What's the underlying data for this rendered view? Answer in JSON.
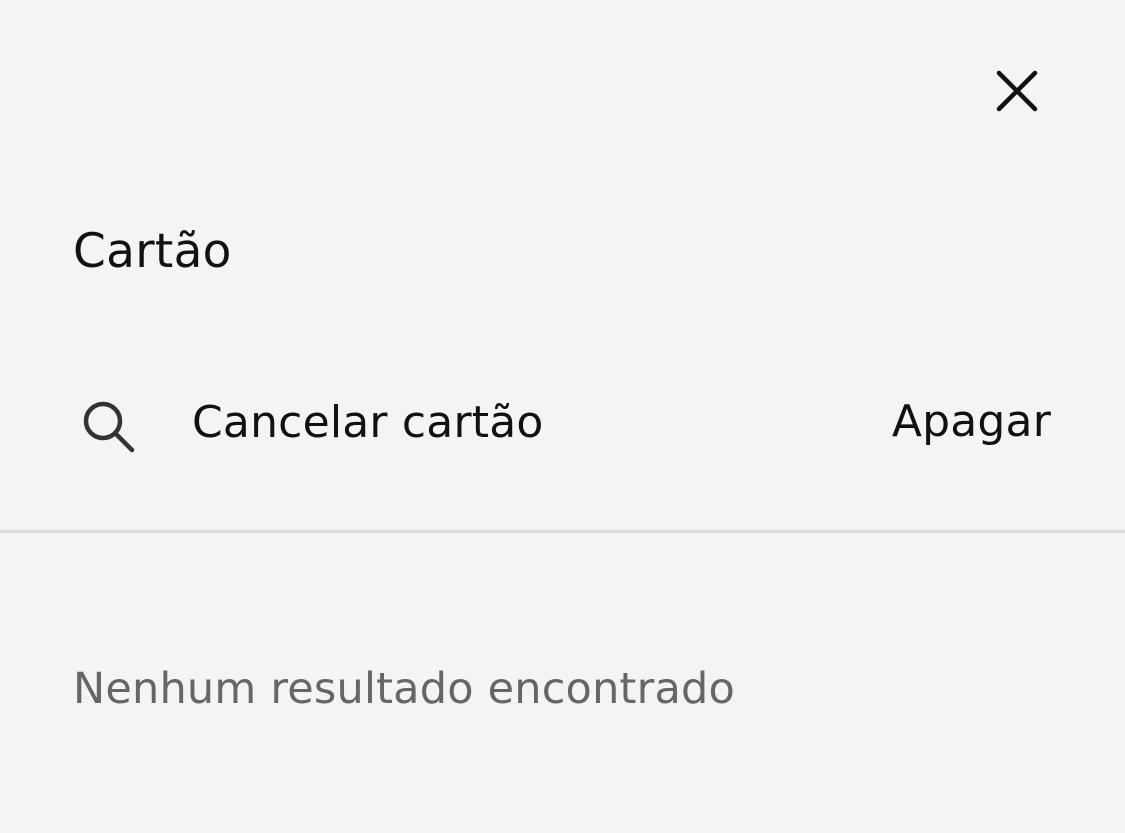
{
  "header": {
    "close_icon": "close-icon"
  },
  "title": "Cartão",
  "search": {
    "icon": "search-icon",
    "value": "Cancelar cartão",
    "clear_label": "Apagar"
  },
  "results": {
    "empty_message": "Nenhum resultado encontrado"
  },
  "colors": {
    "background": "#f4f4f6",
    "text": "#111111",
    "muted_text": "#666668",
    "divider": "#dcdce0"
  }
}
